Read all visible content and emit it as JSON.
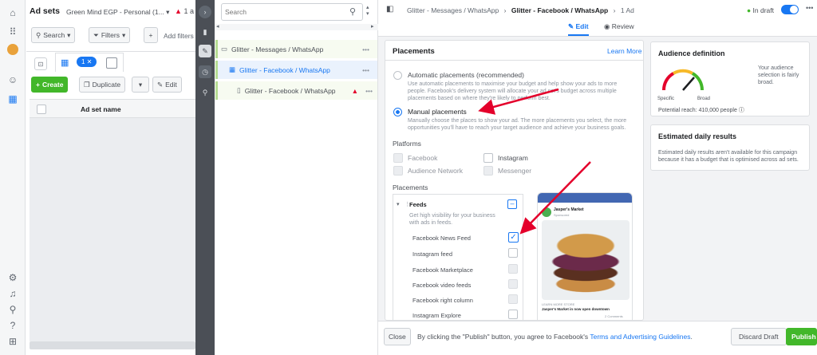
{
  "left_rail": {
    "icons": [
      "home-icon",
      "apps-grid-icon",
      "account-avatar-icon",
      "smiley-icon",
      "table-icon",
      "settings-icon",
      "bell-icon",
      "search-icon",
      "help-icon",
      "grid-icon"
    ]
  },
  "adsets": {
    "title": "Ad sets",
    "account": "Green Mind EGP - Personal (1...",
    "warning_count": "1 a",
    "search_label": "Search",
    "filters_label": "Filters",
    "add_filters": "Add filters",
    "selected_count": "1",
    "create_label": "Create",
    "duplicate_label": "Duplicate",
    "edit_label": "Edit",
    "column_header": "Ad set name"
  },
  "tree": {
    "search_placeholder": "Search",
    "items": [
      {
        "label": "Glitter - Messages / WhatsApp"
      },
      {
        "label": "Glitter - Facebook / WhatsApp"
      },
      {
        "label": "Glitter - Facebook / WhatsApp"
      }
    ]
  },
  "editor": {
    "breadcrumb": {
      "campaign": "Glitter - Messages / WhatsApp",
      "adset": "Glitter - Facebook / WhatsApp",
      "ad": "1 Ad"
    },
    "status": "In draft",
    "tabs": {
      "edit": "Edit",
      "review": "Review"
    },
    "placements": {
      "title": "Placements",
      "learn_more": "Learn More",
      "auto_label": "Automatic placements (recommended)",
      "auto_desc": "Use automatic placements to maximise your budget and help show your ads to more people. Facebook's delivery system will allocate your ad set's budget across multiple placements based on where they're likely to perform best.",
      "manual_label": "Manual placements",
      "manual_desc": "Manually choose the places to show your ad. The more placements you select, the more opportunities you'll have to reach your target audience and achieve your business goals.",
      "platforms_title": "Platforms",
      "platforms": [
        "Facebook",
        "Instagram",
        "Audience Network",
        "Messenger"
      ],
      "placements_title": "Placements",
      "feeds_label": "Feeds",
      "feeds_desc": "Get high visibility for your business with ads in feeds.",
      "rows": [
        "Facebook News Feed",
        "Instagram feed",
        "Facebook Marketplace",
        "Facebook video feeds",
        "Facebook right column",
        "Instagram Explore"
      ]
    },
    "preview": {
      "page_name": "Jasper's Market",
      "sponsored": "Sponsored",
      "headline": "LEARN MORE STORE",
      "caption": "Jasper's Market in now open downtown",
      "comments": "2 Comments"
    },
    "audience": {
      "title": "Audience definition",
      "specific": "Specific",
      "broad": "Broad",
      "desc": "Your audience selection is fairly broad.",
      "reach": "Potential reach: 410,000 people"
    },
    "daily": {
      "title": "Estimated daily results",
      "desc": "Estimated daily results aren't available for this campaign because it has a budget that is optimised across ad sets."
    },
    "footer": {
      "close": "Close",
      "agreement": "By clicking the \"Publish\" button, you agree to Facebook's",
      "terms": "Terms and Advertising Guidelines",
      "period": ".",
      "discard": "Discard Draft",
      "publish": "Publish"
    }
  }
}
